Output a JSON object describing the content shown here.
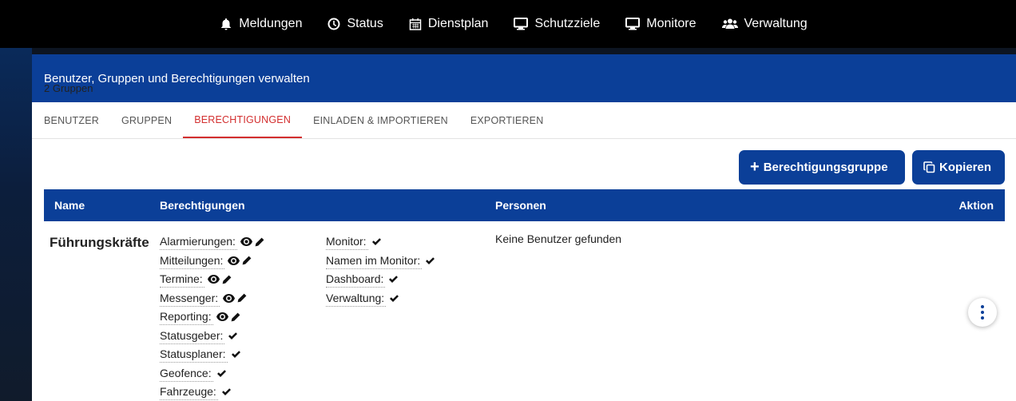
{
  "nav": {
    "items": [
      {
        "label": "Meldungen",
        "icon": "bell-icon"
      },
      {
        "label": "Status",
        "icon": "clock-icon"
      },
      {
        "label": "Dienstplan",
        "icon": "calendar-icon"
      },
      {
        "label": "Schutzziele",
        "icon": "desktop-icon"
      },
      {
        "label": "Monitore",
        "icon": "desktop-icon"
      },
      {
        "label": "Verwaltung",
        "icon": "users-icon"
      }
    ]
  },
  "header": {
    "title": "Benutzer, Gruppen und Berechtigungen verwalten"
  },
  "tabs": [
    {
      "label": "BENUTZER",
      "active": false
    },
    {
      "label": "GRUPPEN",
      "active": false
    },
    {
      "label": "BERECHTIGUNGEN",
      "active": true
    },
    {
      "label": "EINLADEN & IMPORTIEREN",
      "active": false
    },
    {
      "label": "EXPORTIEREN",
      "active": false
    }
  ],
  "toolbar": {
    "count": "2 Gruppen",
    "add_label": "Berechtigungsgruppe",
    "copy_label": "Kopieren"
  },
  "table": {
    "headers": {
      "name": "Name",
      "perms": "Berechtigungen",
      "persons": "Personen",
      "action": "Aktion"
    },
    "row": {
      "name": "Führungskräfte",
      "perms_left": [
        {
          "label": "Alarmierungen:",
          "icons": [
            "eye-icon",
            "pencil-icon"
          ]
        },
        {
          "label": "Mitteilungen:",
          "icons": [
            "eye-icon",
            "pencil-icon"
          ]
        },
        {
          "label": "Termine:",
          "icons": [
            "eye-icon",
            "pencil-icon"
          ]
        },
        {
          "label": "Messenger:",
          "icons": [
            "eye-icon",
            "pencil-icon"
          ]
        },
        {
          "label": "Reporting:",
          "icons": [
            "eye-icon",
            "pencil-icon"
          ]
        },
        {
          "label": "Statusgeber:",
          "icons": [
            "check-icon"
          ]
        },
        {
          "label": "Statusplaner:",
          "icons": [
            "check-icon"
          ]
        },
        {
          "label": "Geofence:",
          "icons": [
            "check-icon"
          ]
        },
        {
          "label": "Fahrzeuge:",
          "icons": [
            "check-icon"
          ]
        }
      ],
      "perms_right": [
        {
          "label": "Monitor:",
          "icons": [
            "check-icon"
          ]
        },
        {
          "label": "Namen im Monitor:",
          "icons": [
            "check-icon"
          ]
        },
        {
          "label": "Dashboard:",
          "icons": [
            "check-icon"
          ]
        },
        {
          "label": "Verwaltung:",
          "icons": [
            "check-icon"
          ]
        }
      ],
      "persons": "Keine Benutzer gefunden"
    }
  },
  "colors": {
    "primary": "#0b3f98",
    "active_tab": "#d32f2f",
    "topbar": "#000000"
  }
}
